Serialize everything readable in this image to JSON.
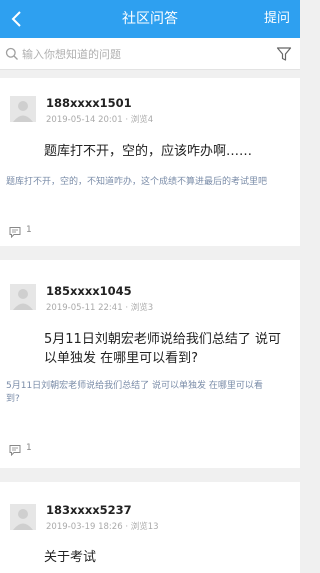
{
  "header": {
    "back_icon": "chevron-left-icon",
    "title": "社区问答",
    "ask_label": "提问",
    "background": "#2ea0f0"
  },
  "search": {
    "placeholder": "输入你想知道的问题",
    "value": "",
    "filter_icon": "funnel-icon"
  },
  "questions": [
    {
      "user": "188xxxx1501",
      "date": "2019-05-14 20:01",
      "views": "浏览4",
      "title_line1": "题库打不开，空的，应该咋办啊……",
      "title_line2": "",
      "excerpt_line1": "题库打不开，空的，不知道咋办，这个成绩不算进最后的考试里吧",
      "excerpt_line2": "",
      "replies": "1"
    },
    {
      "user": "185xxxx1045",
      "date": "2019-05-11 22:41",
      "views": "浏览3",
      "title_line1": "5月11日刘朝宏老师说给我们总结了 说可",
      "title_line2": "以单独发 在哪里可以看到?",
      "excerpt_line1": "5月11日刘朝宏老师说给我们总结了 说可以单独发 在哪里可以看",
      "excerpt_line2": "到?",
      "replies": "1"
    },
    {
      "user": "183xxxx5237",
      "date": "2019-03-19 18:26",
      "views": "浏览13",
      "title_line1": "关于考试",
      "title_line2": "",
      "excerpt_line1": "",
      "excerpt_line2": "",
      "replies": ""
    }
  ]
}
